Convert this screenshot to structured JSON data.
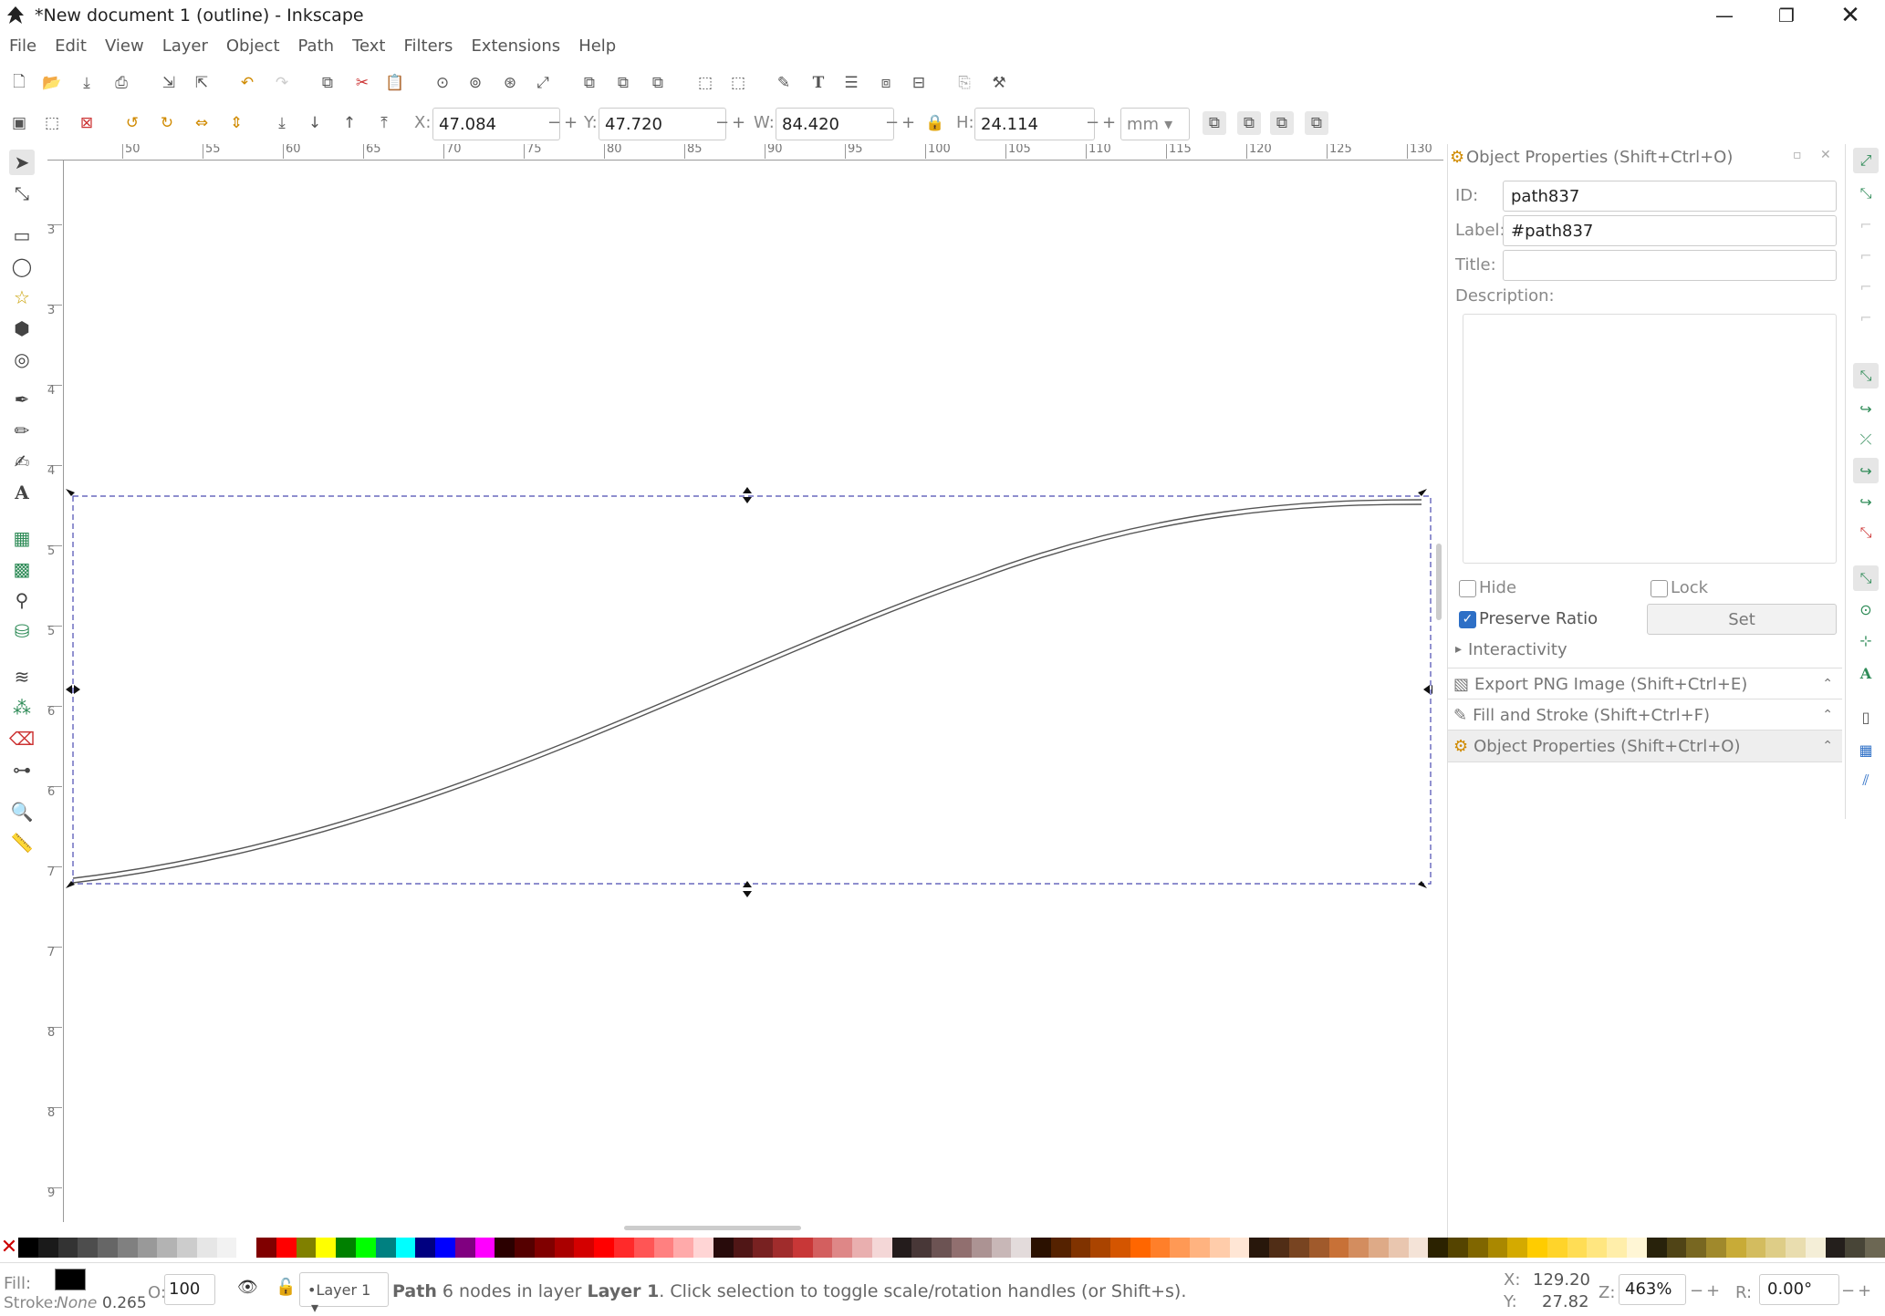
{
  "window": {
    "title": "*New document 1 (outline) - Inkscape",
    "minimize_icon": "minimize-icon",
    "maximize_icon": "restore-icon",
    "close_icon": "close-icon"
  },
  "menu": [
    "File",
    "Edit",
    "View",
    "Layer",
    "Object",
    "Path",
    "Text",
    "Filters",
    "Extensions",
    "Help"
  ],
  "selector_toolbar": {
    "x_label": "X:",
    "x_value": "47.084",
    "y_label": "Y:",
    "y_value": "47.720",
    "w_label": "W:",
    "w_value": "84.420",
    "h_label": "H:",
    "h_value": "24.114",
    "unit": "mm",
    "minus": "−",
    "plus": "+",
    "dropdown": "▾"
  },
  "ruler_top": [
    "50",
    "55",
    "60",
    "65",
    "70",
    "75",
    "80",
    "85",
    "90",
    "95",
    "100",
    "105",
    "110",
    "115",
    "120",
    "125",
    "130"
  ],
  "ruler_left": [
    "3",
    "3",
    "4",
    "4",
    "5",
    "5",
    "6",
    "6",
    "7",
    "7",
    "8",
    "8",
    "9"
  ],
  "object_properties": {
    "header": "Object Properties (Shift+Ctrl+O)",
    "id_label": "ID:",
    "id_value": "path837",
    "label_label": "Label:",
    "label_value": "#path837",
    "title_label": "Title:",
    "title_value": "",
    "description_label": "Description:",
    "hide_label": "Hide",
    "lock_label": "Lock",
    "preserve_ratio_label": "Preserve Ratio",
    "set_button": "Set",
    "interactivity_label": "Interactivity",
    "checkmark": "✓",
    "expander": "▸",
    "collapse": "⌃"
  },
  "docked_dialogs": [
    "Export PNG Image (Shift+Ctrl+E)",
    "Fill and Stroke (Shift+Ctrl+F)",
    "Object Properties (Shift+Ctrl+O)"
  ],
  "status": {
    "fill_label": "Fill:",
    "stroke_label": "Stroke:",
    "stroke_value": "None",
    "stroke_width": "0.265",
    "opacity_label": "O:",
    "opacity_value": "100",
    "layer": "•Layer 1",
    "message_prefix": "Path",
    "message_body": "6 nodes in layer",
    "message_layer": "Layer 1",
    "message_suffix": ". Click selection to toggle scale/rotation handles (or Shift+s).",
    "cursor_x_label": "X:",
    "cursor_x": "129.20",
    "cursor_y_label": "Y:",
    "cursor_y": "27.82",
    "zoom_label": "Z:",
    "zoom_value": "463%",
    "rotation_label": "R:",
    "rotation_value": "0.00°"
  },
  "colors": {
    "selection_dash": "#4a4ab0",
    "accent": "#2d6fc6",
    "snap_icons": "#2e8b57"
  },
  "palette": [
    "#000000",
    "#1a1a1a",
    "#333333",
    "#4d4d4d",
    "#666666",
    "#808080",
    "#999999",
    "#b3b3b3",
    "#cccccc",
    "#e6e6e6",
    "#f2f2f2",
    "#ffffff",
    "#800000",
    "#ff0000",
    "#808000",
    "#ffff00",
    "#008000",
    "#00ff00",
    "#008080",
    "#00ffff",
    "#000080",
    "#0000ff",
    "#800080",
    "#ff00ff",
    "#2b0000",
    "#550000",
    "#800000",
    "#aa0000",
    "#d40000",
    "#ff0000",
    "#ff2a2a",
    "#ff5555",
    "#ff8080",
    "#ffaaaa",
    "#ffd5d5",
    "#280b0b",
    "#501616",
    "#782121",
    "#a02c2c",
    "#c83737",
    "#d35f5f",
    "#de8787",
    "#e9afaf",
    "#f4d7d7",
    "#241c1c",
    "#483737",
    "#6c5353",
    "#916f6f",
    "#ac9393",
    "#c8b7b7",
    "#e3dbdb",
    "#2b1100",
    "#552200",
    "#803300",
    "#aa4400",
    "#d45500",
    "#ff6600",
    "#ff7f2a",
    "#ff9955",
    "#ffb380",
    "#ffccaa",
    "#ffe6d5",
    "#28170b",
    "#502d16",
    "#784421",
    "#a05a2c",
    "#c87137",
    "#d38d5f",
    "#deaa87",
    "#e9c6af",
    "#f4e3d7",
    "#2b2200",
    "#554400",
    "#806600",
    "#aa8800",
    "#d4aa00",
    "#ffcc00",
    "#ffd42a",
    "#ffdd55",
    "#ffe680",
    "#ffeeaa",
    "#fff6d5",
    "#28220b",
    "#504416",
    "#786721",
    "#a0892c",
    "#c8ab37",
    "#d3bc5f",
    "#decd87",
    "#e9ddaf",
    "#f4eed7",
    "#241f1c",
    "#484537",
    "#6c6753"
  ]
}
